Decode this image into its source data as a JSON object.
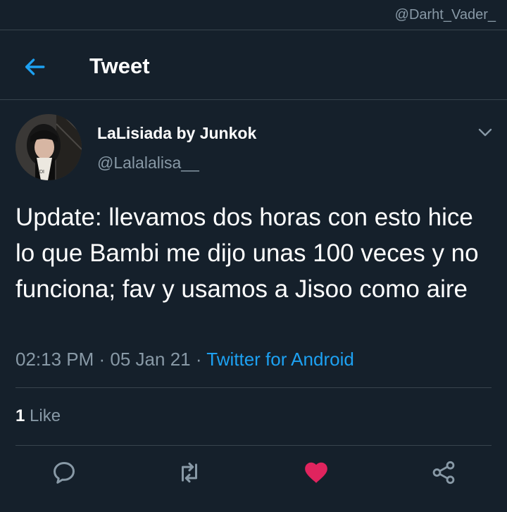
{
  "watermark": "@Darht_Vader_",
  "header": {
    "title": "Tweet",
    "back_icon": "arrow-left-icon"
  },
  "tweet": {
    "author": {
      "display_name": "LaLisiada by Junkok",
      "handle": "@Lalalalisa__"
    },
    "text": "Update: llevamos dos horas con esto hice lo que Bambi me dijo unas 100 veces y no funciona; fav y usamos a Jisoo como aire",
    "time": "02:13 PM",
    "date": "05 Jan 21",
    "separator": " · ",
    "source": "Twitter for Android",
    "likes": {
      "count": "1",
      "label": "Like"
    }
  },
  "actions": {
    "reply_icon": "reply-icon",
    "retweet_icon": "retweet-icon",
    "like_icon": "heart-filled-icon",
    "share_icon": "share-icon"
  },
  "colors": {
    "background": "#15202b",
    "accent": "#1da1f2",
    "like": "#e0245e",
    "secondary_text": "#8899a6",
    "divider": "#38444d"
  }
}
